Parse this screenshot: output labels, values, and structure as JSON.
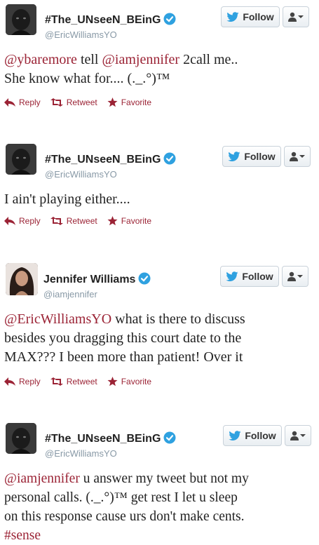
{
  "tweets": [
    {
      "name": "#The_UNseeN_BEinG",
      "handle": "@EricWilliamsYO",
      "follow_label": "Follow",
      "text_parts": [
        "@ybaremore",
        " tell ",
        "@iamjennifer",
        " 2call me..",
        "She know what for.... (._.°)™"
      ],
      "reply_label": "Reply",
      "retweet_label": "Retweet",
      "favorite_label": "Favorite"
    },
    {
      "name": "#The_UNseeN_BEinG",
      "handle": "@EricWilliamsYO",
      "follow_label": "Follow",
      "text_parts": [
        "I ain't playing either...."
      ],
      "reply_label": "Reply",
      "retweet_label": "Retweet",
      "favorite_label": "Favorite"
    },
    {
      "name": "Jennifer Williams",
      "handle": "@iamjennifer",
      "follow_label": "Follow",
      "text_parts": [
        "@EricWilliamsYO",
        " what is there to discuss",
        "besides you dragging this court date to the",
        "MAX??? I been more than patient! Over it"
      ],
      "reply_label": "Reply",
      "retweet_label": "Retweet",
      "favorite_label": "Favorite"
    },
    {
      "name": "#The_UNseeN_BEinG",
      "handle": "@EricWilliamsYO",
      "follow_label": "Follow",
      "text_parts": [
        "@iamjennifer",
        " u answer my tweet but not my",
        "personal calls. (._.°)™ get rest I let u sleep",
        "on this response cause urs don't make cents.",
        "#sense"
      ]
    }
  ],
  "colors": {
    "link": "#9b2335",
    "handle": "#8899a6",
    "twitter_blue": "#2fa1e0",
    "verified": "#2fa1e0"
  },
  "icons": {
    "verified": "verified-badge-icon",
    "follow": "twitter-bird-icon",
    "user_dropdown": "user-icon",
    "reply": "reply-arrow-icon",
    "retweet": "retweet-icon",
    "favorite": "star-icon"
  }
}
